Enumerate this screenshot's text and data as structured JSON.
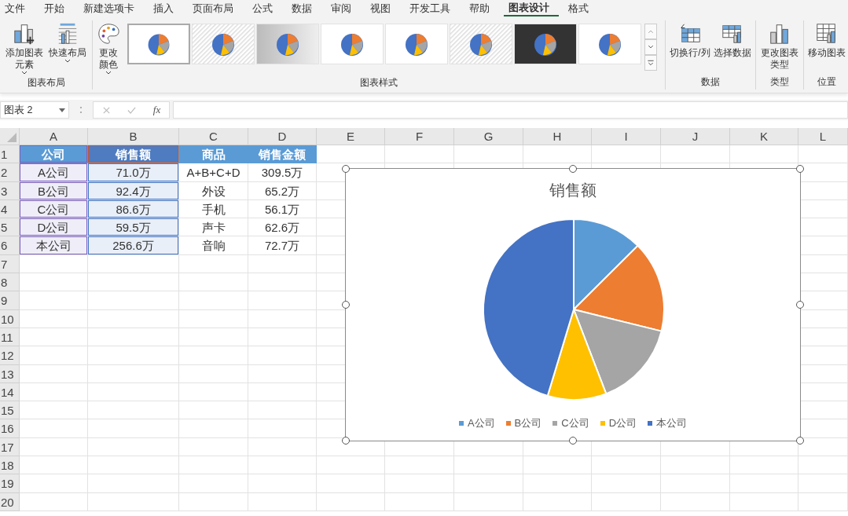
{
  "ribbon_tabs": [
    {
      "label": "文件",
      "selected": false
    },
    {
      "label": "开始",
      "selected": false
    },
    {
      "label": "新建选项卡",
      "selected": false
    },
    {
      "label": "插入",
      "selected": false
    },
    {
      "label": "页面布局",
      "selected": false
    },
    {
      "label": "公式",
      "selected": false
    },
    {
      "label": "数据",
      "selected": false
    },
    {
      "label": "审阅",
      "selected": false
    },
    {
      "label": "视图",
      "selected": false
    },
    {
      "label": "开发工具",
      "selected": false
    },
    {
      "label": "帮助",
      "selected": false
    },
    {
      "label": "图表设计",
      "selected": true
    },
    {
      "label": "格式",
      "selected": false
    }
  ],
  "ribbon": {
    "layout_group": {
      "label": "图表布局",
      "buttons": [
        {
          "label": "添加图表元素",
          "kind": "add-element"
        },
        {
          "label": "快速布局",
          "kind": "quick-layout"
        }
      ]
    },
    "styles_group": {
      "label": "图表样式",
      "color_button": "更改颜色",
      "gallery": [
        {
          "selected": true,
          "kind": "plain"
        },
        {
          "selected": false,
          "kind": "hatched"
        },
        {
          "selected": false,
          "kind": "gradient"
        },
        {
          "selected": false,
          "kind": "plain"
        },
        {
          "selected": false,
          "kind": "plain"
        },
        {
          "selected": false,
          "kind": "hatched"
        },
        {
          "selected": false,
          "kind": "dark"
        },
        {
          "selected": false,
          "kind": "plain"
        }
      ]
    },
    "data_group": {
      "label": "数据",
      "buttons": [
        {
          "label": "切换行/列",
          "kind": "switch"
        },
        {
          "label": "选择数据",
          "kind": "select-data"
        }
      ]
    },
    "type_group": {
      "label": "类型",
      "button": "更改图表类型"
    },
    "location_group": {
      "label": "位置",
      "button": "移动图表"
    }
  },
  "formula_bar": {
    "name_box": "图表 2",
    "fx": "fx"
  },
  "columns": [
    "A",
    "B",
    "C",
    "D",
    "E",
    "F",
    "G",
    "H",
    "I",
    "J",
    "K",
    "L"
  ],
  "rows": [
    {
      "number": "1",
      "cells": [
        {
          "text": "公司",
          "kind": "category-header"
        },
        {
          "text": "销售额",
          "kind": "series-header"
        },
        {
          "text": "商品",
          "kind": "header"
        },
        {
          "text": "销售金额",
          "kind": "header"
        }
      ]
    },
    {
      "number": "2",
      "cells": [
        {
          "text": "A公司",
          "kind": "category"
        },
        {
          "text": "71.0万",
          "kind": "value"
        },
        {
          "text": "A+B+C+D",
          "kind": "plain"
        },
        {
          "text": "309.5万",
          "kind": "plain"
        }
      ]
    },
    {
      "number": "3",
      "cells": [
        {
          "text": "B公司",
          "kind": "category"
        },
        {
          "text": "92.4万",
          "kind": "value"
        },
        {
          "text": "外设",
          "kind": "plain"
        },
        {
          "text": "65.2万",
          "kind": "plain"
        }
      ]
    },
    {
      "number": "4",
      "cells": [
        {
          "text": "C公司",
          "kind": "category"
        },
        {
          "text": "86.6万",
          "kind": "value"
        },
        {
          "text": "手机",
          "kind": "plain"
        },
        {
          "text": "56.1万",
          "kind": "plain"
        }
      ]
    },
    {
      "number": "5",
      "cells": [
        {
          "text": "D公司",
          "kind": "category"
        },
        {
          "text": "59.5万",
          "kind": "value"
        },
        {
          "text": "声卡",
          "kind": "plain"
        },
        {
          "text": "62.6万",
          "kind": "plain"
        }
      ]
    },
    {
      "number": "6",
      "cells": [
        {
          "text": "本公司",
          "kind": "category"
        },
        {
          "text": "256.6万",
          "kind": "value"
        },
        {
          "text": "音响",
          "kind": "plain"
        },
        {
          "text": "72.7万",
          "kind": "plain"
        }
      ]
    },
    {
      "number": "7",
      "cells": []
    },
    {
      "number": "8",
      "cells": []
    },
    {
      "number": "9",
      "cells": []
    },
    {
      "number": "10",
      "cells": []
    },
    {
      "number": "11",
      "cells": []
    },
    {
      "number": "12",
      "cells": []
    },
    {
      "number": "13",
      "cells": []
    },
    {
      "number": "14",
      "cells": []
    },
    {
      "number": "15",
      "cells": []
    },
    {
      "number": "16",
      "cells": []
    },
    {
      "number": "17",
      "cells": []
    },
    {
      "number": "18",
      "cells": []
    },
    {
      "number": "19",
      "cells": []
    },
    {
      "number": "20",
      "cells": []
    }
  ],
  "chart": {
    "selected": true,
    "chart_data": {
      "type": "pie",
      "title": "销售额",
      "legend": "bottom",
      "categories": [
        "A公司",
        "B公司",
        "C公司",
        "D公司",
        "本公司"
      ],
      "series": [
        {
          "values": [
            12.54,
            16.32,
            15.3,
            10.51,
            45.33
          ]
        }
      ],
      "colors": [
        "#5b9bd5",
        "#ed7d31",
        "#a5a5a5",
        "#ffc000",
        "#4472c4"
      ]
    }
  }
}
